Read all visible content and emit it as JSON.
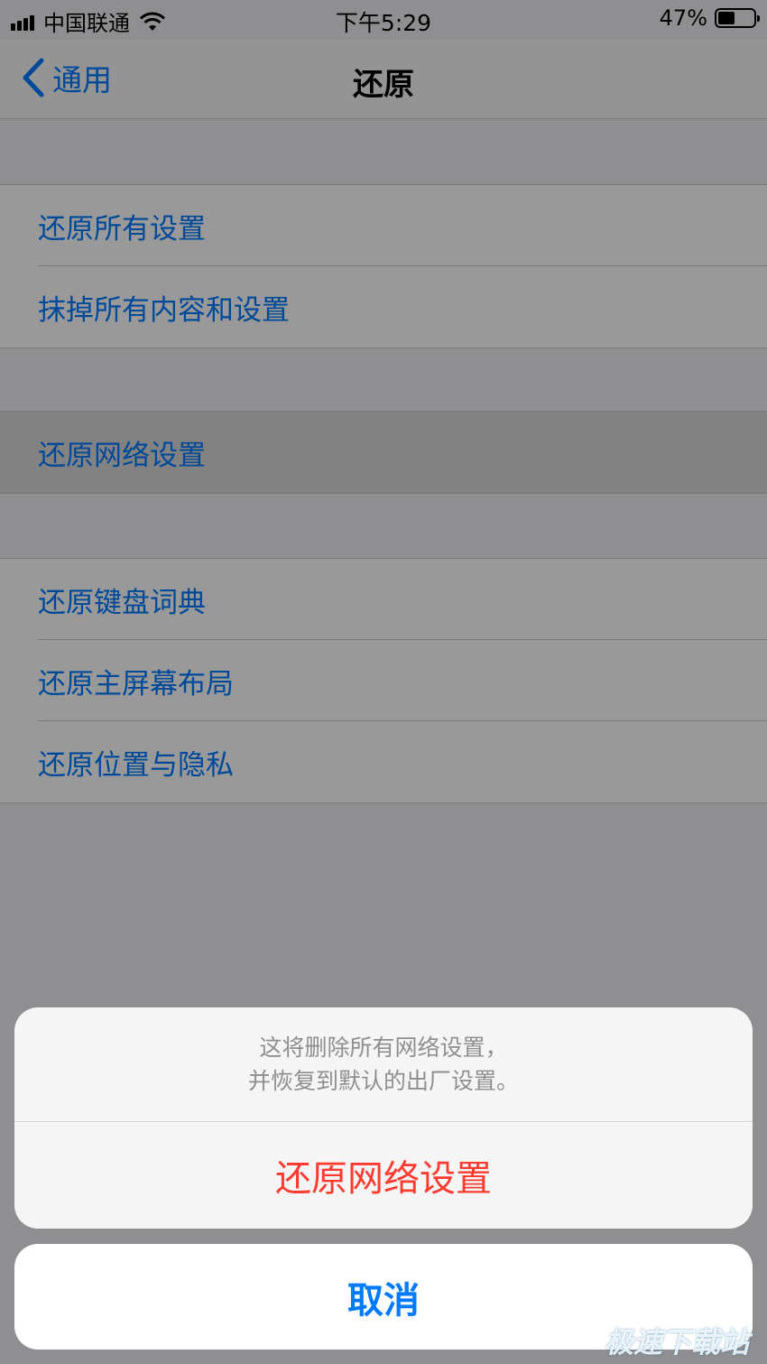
{
  "status_bar": {
    "carrier": "中国联通",
    "time": "下午5:29",
    "battery_percent": "47%",
    "battery_level": 0.47
  },
  "nav": {
    "back_label": "通用",
    "title": "还原"
  },
  "groups": [
    {
      "items": [
        {
          "label": "还原所有设置"
        },
        {
          "label": "抹掉所有内容和设置"
        }
      ]
    },
    {
      "items": [
        {
          "label": "还原网络设置",
          "pressed": true
        }
      ]
    },
    {
      "items": [
        {
          "label": "还原键盘词典"
        },
        {
          "label": "还原主屏幕布局"
        },
        {
          "label": "还原位置与隐私"
        }
      ]
    }
  ],
  "action_sheet": {
    "message_line1": "这将删除所有网络设置，",
    "message_line2": "并恢复到默认的出厂设置。",
    "destructive_label": "还原网络设置",
    "cancel_label": "取消"
  },
  "watermark": "极速下载站",
  "colors": {
    "accent": "#007aff",
    "destructive": "#ff3b30"
  }
}
